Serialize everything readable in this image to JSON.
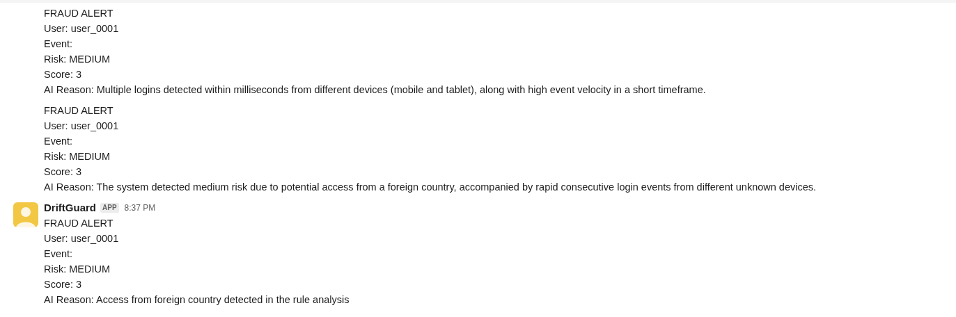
{
  "messages": [
    {
      "lines": [
        "FRAUD ALERT",
        "User: user_0001",
        "Event:",
        "Risk: MEDIUM",
        "Score: 3",
        "AI Reason: Multiple logins detected within milliseconds from different devices (mobile and tablet), along with high event velocity in a short timeframe."
      ]
    },
    {
      "lines": [
        "FRAUD ALERT",
        "User: user_0001",
        "Event:",
        "Risk: MEDIUM",
        "Score: 3",
        "AI Reason: The system detected medium risk due to potential access from a foreign country, accompanied by rapid consecutive login events from different unknown devices."
      ]
    },
    {
      "header": {
        "sender": "DriftGuard",
        "badge": "APP",
        "time": "8:37 PM"
      },
      "lines": [
        "FRAUD ALERT",
        "User: user_0001",
        "Event:",
        "Risk: MEDIUM",
        "Score: 3",
        "AI Reason: Access from foreign country detected in the rule analysis"
      ]
    }
  ]
}
